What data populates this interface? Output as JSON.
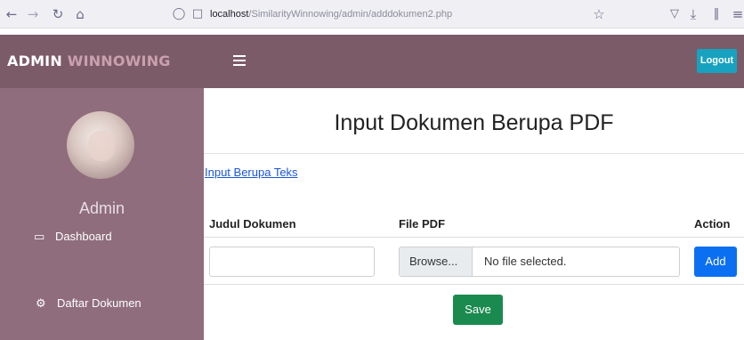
{
  "browser": {
    "url_host": "localhost",
    "url_path": "/SimilarityWinnowing/admin/adddokumen2.php"
  },
  "navbar": {
    "brand_main": "ADMIN",
    "brand_accent": "WINNOWING",
    "logout_label": "Logout"
  },
  "sidebar": {
    "user_name": "Admin",
    "items": [
      {
        "label": "Dashboard",
        "icon": "monitor-icon"
      },
      {
        "label": "Daftar Dokumen",
        "icon": "cogs-icon"
      }
    ]
  },
  "main": {
    "title": "Input Dokumen Berupa PDF",
    "text_link": "Input Berupa Teks",
    "columns": [
      "Judul Dokumen",
      "File PDF",
      "Action"
    ],
    "judul_value": "",
    "browse_label": "Browse...",
    "file_status": "No file selected.",
    "add_label": "Add",
    "save_label": "Save"
  },
  "colors": {
    "navbar": "#7c5b68",
    "sidebar": "#8f6d7c",
    "brand_accent": "#cba0ae",
    "logout": "#17a2c0",
    "add": "#0b6ff2",
    "save": "#1a8a4f",
    "link": "#1a56d6"
  }
}
